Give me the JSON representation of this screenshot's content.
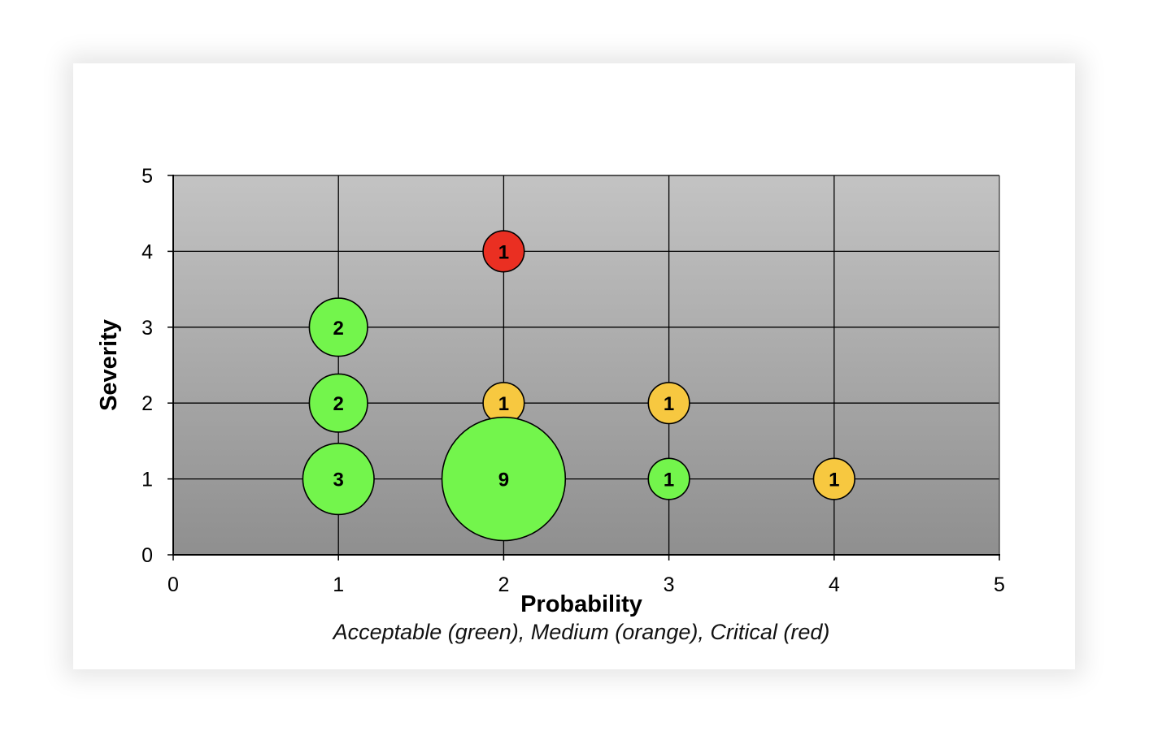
{
  "chart_data": {
    "type": "scatter",
    "subtype": "bubble",
    "xlabel": "Probability",
    "ylabel": "Severity",
    "caption": "Acceptable (green), Medium (orange), Critical (red)",
    "xlim": [
      0,
      5
    ],
    "ylim": [
      0,
      5
    ],
    "xticks": [
      0,
      1,
      2,
      3,
      4,
      5
    ],
    "yticks": [
      0,
      1,
      2,
      3,
      4,
      5
    ],
    "grid": true,
    "plot_background": "gradient light-to-dark gray",
    "colors": {
      "green": "#73f54c",
      "orange": "#f7c840",
      "red": "#ea2f22",
      "grid": "#000000",
      "plot_top": "#c3c3c3",
      "plot_bottom": "#8f8f8f"
    },
    "points": [
      {
        "x": 1,
        "y": 3,
        "size": 2,
        "label": "2",
        "color": "green"
      },
      {
        "x": 1,
        "y": 2,
        "size": 2,
        "label": "2",
        "color": "green"
      },
      {
        "x": 1,
        "y": 1,
        "size": 3,
        "label": "3",
        "color": "green"
      },
      {
        "x": 2,
        "y": 4,
        "size": 1,
        "label": "1",
        "color": "red"
      },
      {
        "x": 2,
        "y": 2,
        "size": 1,
        "label": "1",
        "color": "orange"
      },
      {
        "x": 2,
        "y": 1,
        "size": 9,
        "label": "9",
        "color": "green"
      },
      {
        "x": 3,
        "y": 2,
        "size": 1,
        "label": "1",
        "color": "orange"
      },
      {
        "x": 3,
        "y": 1,
        "size": 1,
        "label": "1",
        "color": "green"
      },
      {
        "x": 4,
        "y": 1,
        "size": 1,
        "label": "1",
        "color": "orange"
      }
    ]
  }
}
